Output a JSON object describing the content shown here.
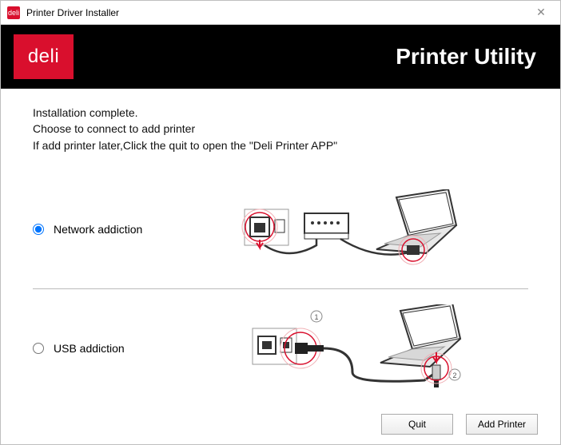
{
  "window": {
    "title": "Printer Driver Installer",
    "app_icon_text": "deli"
  },
  "banner": {
    "logo_text": "deli",
    "title": "Printer Utility"
  },
  "status": {
    "line1": "Installation complete.",
    "line2": " Choose to connect to add printer",
    "line3": "If add printer later,Click the quit to open the \"Deli Printer APP\""
  },
  "options": {
    "network": {
      "label": "Network addiction",
      "selected": true
    },
    "usb": {
      "label": "USB addiction",
      "selected": false
    }
  },
  "footer": {
    "quit": "Quit",
    "add_printer": "Add Printer"
  },
  "colors": {
    "brand_red": "#d90f2d",
    "banner_bg": "#000000"
  }
}
